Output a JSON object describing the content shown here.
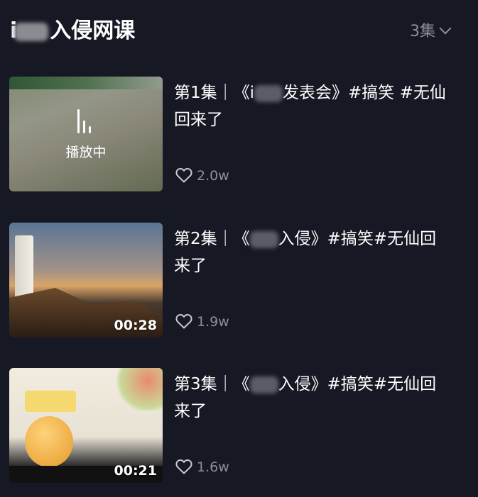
{
  "header": {
    "title_prefix": "i",
    "title_suffix": "入侵网课",
    "episode_count": "3集"
  },
  "episodes": [
    {
      "title_a": "第1集｜《i",
      "title_b": "发表会》#搞笑 #无仙回来了",
      "likes": "2.0w",
      "status": "播放中",
      "duration": ""
    },
    {
      "title_a": "第2集｜《",
      "title_b": "入侵》#搞笑#无仙回来了",
      "likes": "1.9w",
      "status": "",
      "duration": "00:28"
    },
    {
      "title_a": "第3集｜《",
      "title_b": "入侵》#搞笑#无仙回来了",
      "likes": "1.6w",
      "status": "",
      "duration": "00:21"
    }
  ],
  "colors": {
    "background": "#161823",
    "secondary_text": "#8d8f97"
  },
  "icons": {
    "chevron": "chevron-down-icon",
    "heart": "heart-outline-icon",
    "playing": "sound-wave-icon"
  }
}
